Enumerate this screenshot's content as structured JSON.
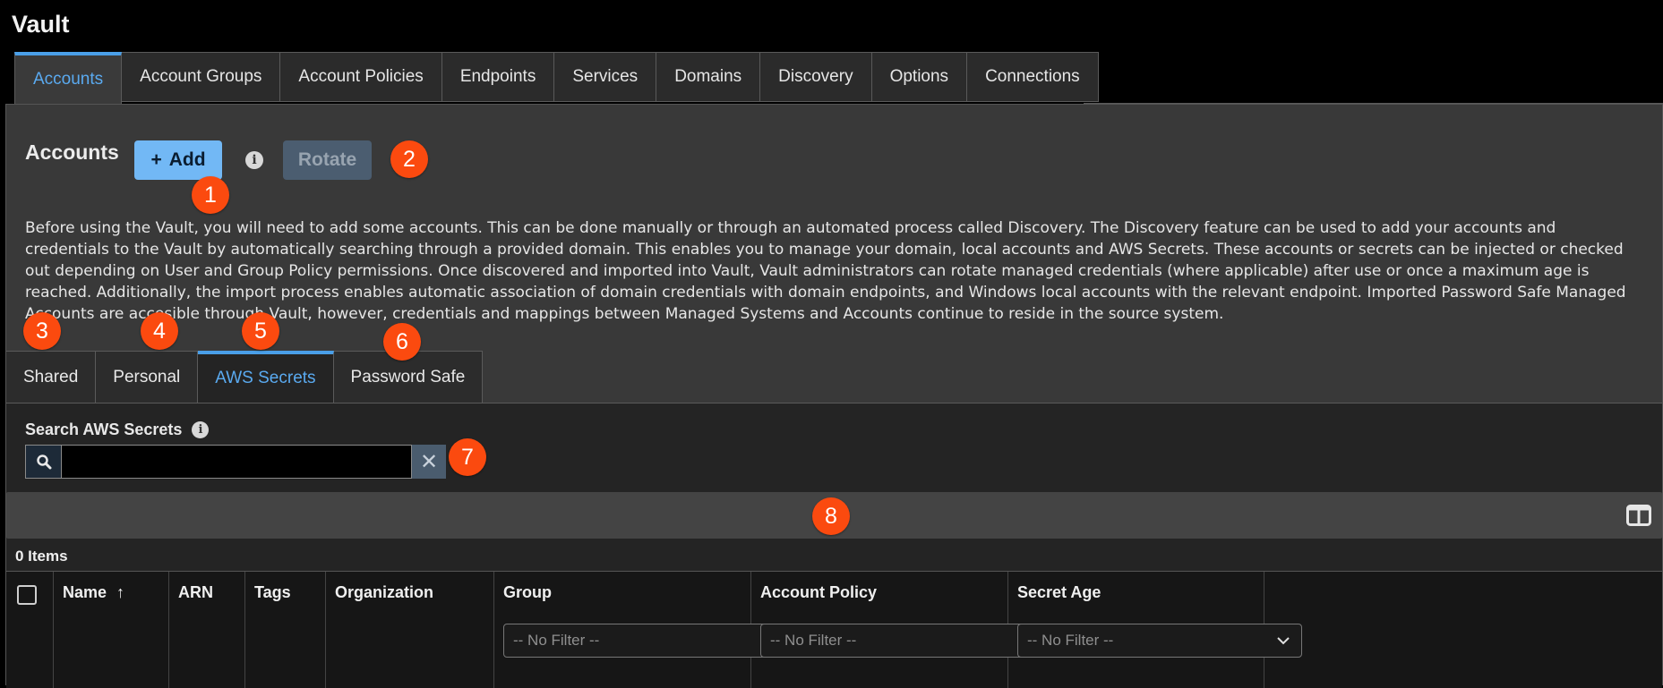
{
  "app": {
    "title": "Vault"
  },
  "top_tabs": [
    {
      "label": "Accounts",
      "active": true
    },
    {
      "label": "Account Groups"
    },
    {
      "label": "Account Policies"
    },
    {
      "label": "Endpoints"
    },
    {
      "label": "Services"
    },
    {
      "label": "Domains"
    },
    {
      "label": "Discovery"
    },
    {
      "label": "Options"
    },
    {
      "label": "Connections"
    }
  ],
  "accounts": {
    "header": "Accounts",
    "add_label": "Add",
    "rotate_label": "Rotate",
    "description": "Before using the Vault, you will need to add some accounts. This can be done manually or through an automated process called Discovery. The Discovery feature can be used to add your accounts and credentials to the Vault by automatically searching through a provided domain. This enables you to manage your domain, local accounts and AWS Secrets. These accounts or secrets can be injected or checked out depending on User and Group Policy permissions. Once discovered and imported into Vault, Vault administrators can rotate managed credentials (where applicable) after use or once a maximum age is reached. Additionally, the import process enables automatic association of domain credentials with domain endpoints, and Windows local accounts with the relevant endpoint. Imported Password Safe Managed Accounts are accesible through Vault, however, credentials and mappings between Managed Systems and Accounts continue to reside in the source system."
  },
  "sub_tabs": [
    {
      "label": "Shared"
    },
    {
      "label": "Personal"
    },
    {
      "label": "AWS Secrets",
      "active": true
    },
    {
      "label": "Password Safe"
    }
  ],
  "search": {
    "label": "Search AWS Secrets",
    "value": "",
    "placeholder": ""
  },
  "items_count": "0 Items",
  "table": {
    "columns": [
      "Name",
      "ARN",
      "Tags",
      "Organization",
      "Group",
      "Account Policy",
      "Secret Age"
    ],
    "sort_indicator": "↑",
    "filter_placeholder": "-- No Filter --"
  },
  "badges": [
    "1",
    "2",
    "3",
    "4",
    "5",
    "6",
    "7",
    "8"
  ],
  "colors": {
    "accent": "#4a9fe8",
    "badge": "#fb4a0f",
    "add_button": "#72b8f5"
  }
}
